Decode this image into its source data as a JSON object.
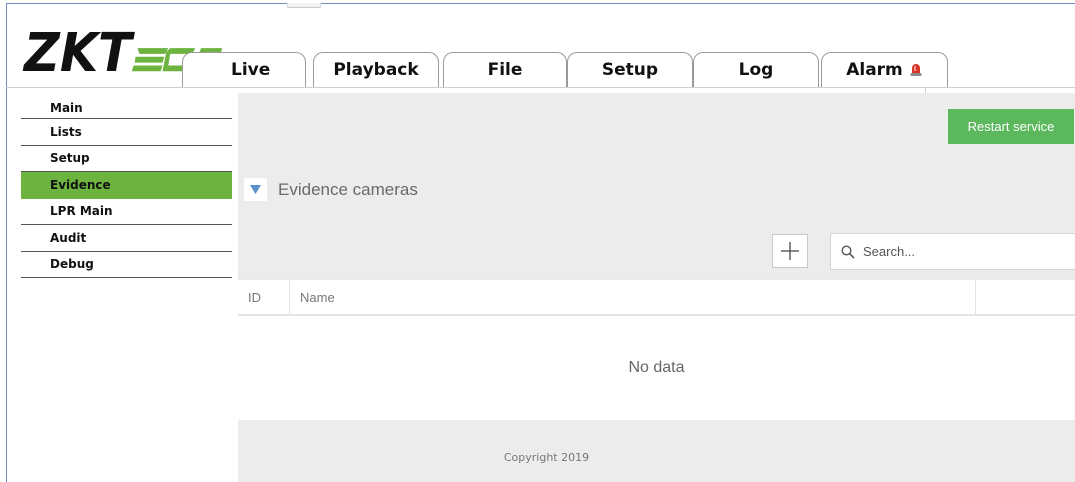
{
  "header": {
    "logo_text": "ZKTeco",
    "tabs": [
      {
        "label": "Live"
      },
      {
        "label": "Playback"
      },
      {
        "label": "File"
      },
      {
        "label": "Setup"
      },
      {
        "label": "Log"
      },
      {
        "label": "Alarm"
      }
    ],
    "alarm_icon": "siren-icon"
  },
  "sidebar": {
    "items": [
      {
        "label": "Main"
      },
      {
        "label": "Lists"
      },
      {
        "label": "Setup"
      },
      {
        "label": "Evidence"
      },
      {
        "label": "LPR Main"
      },
      {
        "label": "Audit"
      },
      {
        "label": "Debug"
      }
    ],
    "active_index": 3
  },
  "main": {
    "restart_label": "Restart service",
    "section_title": "Evidence cameras",
    "search_placeholder": "Search...",
    "table": {
      "columns": [
        "ID",
        "Name",
        ""
      ],
      "empty_text": "No data"
    }
  },
  "footer": {
    "copyright": "Copyright 2019"
  },
  "colors": {
    "accent_green": "#6cb33f",
    "button_green": "#5cb85c",
    "toggle_blue": "#5b8fc9",
    "alarm_red": "#d9362b"
  }
}
